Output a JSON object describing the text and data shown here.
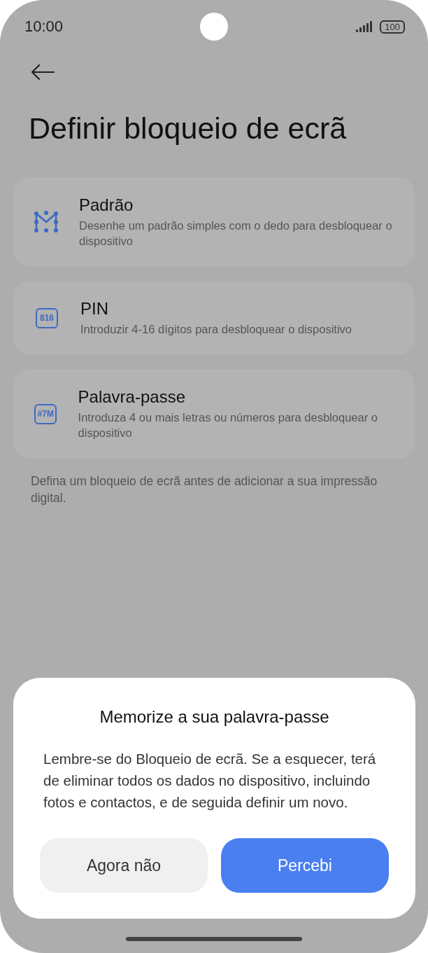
{
  "status_bar": {
    "time": "10:00",
    "battery": "100"
  },
  "title": "Definir bloqueio de ecrã",
  "options": [
    {
      "kind": "pattern",
      "title": "Padrão",
      "description": "Desenhe um padrão simples com o dedo para desbloquear o dispositivo"
    },
    {
      "kind": "pin",
      "icon_text": "816",
      "title": "PIN",
      "description": "Introduzir 4-16 dígitos para desbloquear o dispositivo"
    },
    {
      "kind": "password",
      "icon_text": "#7M",
      "title": "Palavra-passe",
      "description": "Introduza 4 ou mais letras ou números para desbloquear o dispositivo"
    }
  ],
  "note": "Defina um bloqueio de ecrã antes de adicionar a sua impressão digital.",
  "dialog": {
    "title": "Memorize a sua palavra-passe",
    "message": "Lembre-se do Bloqueio de ecrã. Se a esquecer, terá de eliminar todos os dados no dispositivo, incluindo fotos e contactos, e de seguida definir um novo.",
    "buttons": [
      {
        "label": "Agora não",
        "kind": "secondary"
      },
      {
        "label": "Percebi",
        "kind": "primary"
      }
    ]
  }
}
